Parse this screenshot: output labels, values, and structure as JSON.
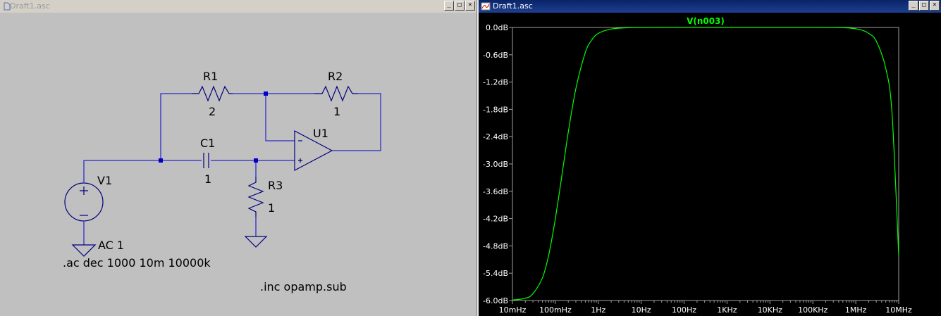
{
  "schematic": {
    "title": "Draft1.asc",
    "labels": {
      "r1": "R1",
      "r1_val": "2",
      "r2": "R2",
      "r2_val": "1",
      "c1": "C1",
      "c1_val": "1",
      "r3": "R3",
      "r3_val": "1",
      "u1": "U1",
      "v1": "V1",
      "v1_val": "AC 1",
      "ac_cmd": ".ac dec 1000 10m 10000k",
      "inc_cmd": ".inc opamp.sub"
    },
    "colors": {
      "wire": "#0000cc",
      "component": "#000080",
      "text": "#000000",
      "background": "#c0c0c0"
    }
  },
  "plot": {
    "title": "Draft1.asc",
    "trace_label": "V(n003)",
    "colors": {
      "background": "#000000",
      "trace": "#00ff00",
      "grid": "#a0a0a0",
      "axis_text": "#ffffff"
    },
    "chart_data": {
      "type": "line",
      "title": "",
      "series": [
        {
          "name": "V(n003)",
          "x": [
            0.01,
            0.02,
            0.03,
            0.05,
            0.07,
            0.1,
            0.15,
            0.2,
            0.3,
            0.5,
            0.7,
            1,
            2,
            5,
            10,
            100,
            1000,
            10000,
            100000,
            300000,
            500000,
            700000,
            1000000,
            1500000,
            2000000,
            3000000,
            5000000,
            7000000,
            10000000
          ],
          "y": [
            -5.99,
            -5.95,
            -5.85,
            -5.5,
            -5.0,
            -4.2,
            -3.1,
            -2.3,
            -1.35,
            -0.55,
            -0.28,
            -0.13,
            -0.035,
            -0.006,
            -0.002,
            0,
            0,
            0,
            0,
            -0.002,
            -0.006,
            -0.013,
            -0.03,
            -0.07,
            -0.13,
            -0.3,
            -0.9,
            -1.9,
            -5.0
          ]
        }
      ],
      "x_scale": "log",
      "x_range": [
        "10mHz",
        "10MHz"
      ],
      "y_range": [
        -6.0,
        0.0
      ],
      "x_tick_labels": [
        "10mHz",
        "100mHz",
        "1Hz",
        "10Hz",
        "100Hz",
        "1KHz",
        "10KHz",
        "100KHz",
        "1MHz",
        "10MHz"
      ],
      "y_tick_labels": [
        "0.0dB",
        "-0.6dB",
        "-1.2dB",
        "-1.8dB",
        "-2.4dB",
        "-3.0dB",
        "-3.6dB",
        "-4.2dB",
        "-4.8dB",
        "-5.4dB",
        "-6.0dB"
      ],
      "grid": false,
      "legend": "top-center"
    }
  }
}
